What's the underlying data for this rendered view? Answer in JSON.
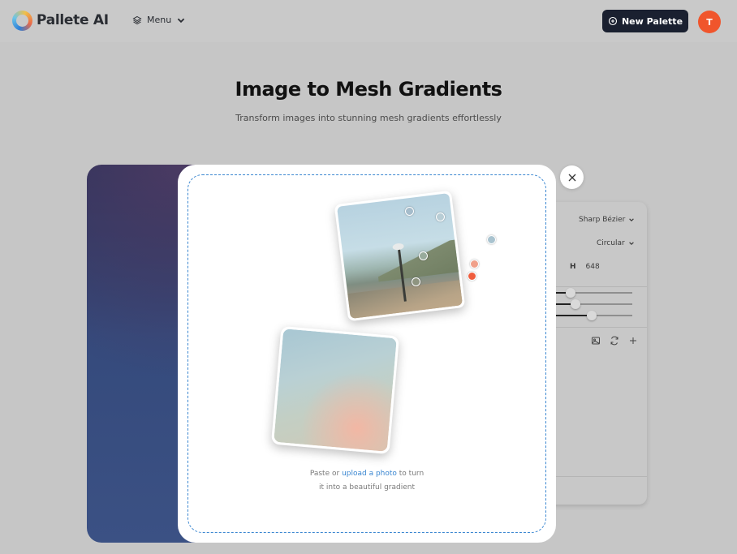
{
  "header": {
    "app_name": "Pallete AI",
    "menu_label": "Menu",
    "new_palette_label": "New Palette",
    "avatar_initial": "T"
  },
  "main": {
    "title": "Image to Mesh Gradients",
    "subtitle": "Transform images into stunning mesh gradients effortlessly"
  },
  "settings_panel": {
    "curve_type": "Sharp Bézier",
    "shape_type": "Circular",
    "height_label": "H",
    "height_value": "648",
    "sliders": [
      0.22,
      0.28,
      0.48
    ]
  },
  "modal": {
    "hint_prefix": "Paste or ",
    "hint_link": "upload a photo",
    "hint_suffix": " to turn",
    "hint_line2": "it into a beautiful gradient",
    "color_dots": [
      "#a9c3cf",
      "#f0a08a",
      "#ef5d3e"
    ]
  },
  "colors": {
    "accent_dark": "#1a2030",
    "avatar": "#f0552c",
    "link": "#3b87d1"
  }
}
